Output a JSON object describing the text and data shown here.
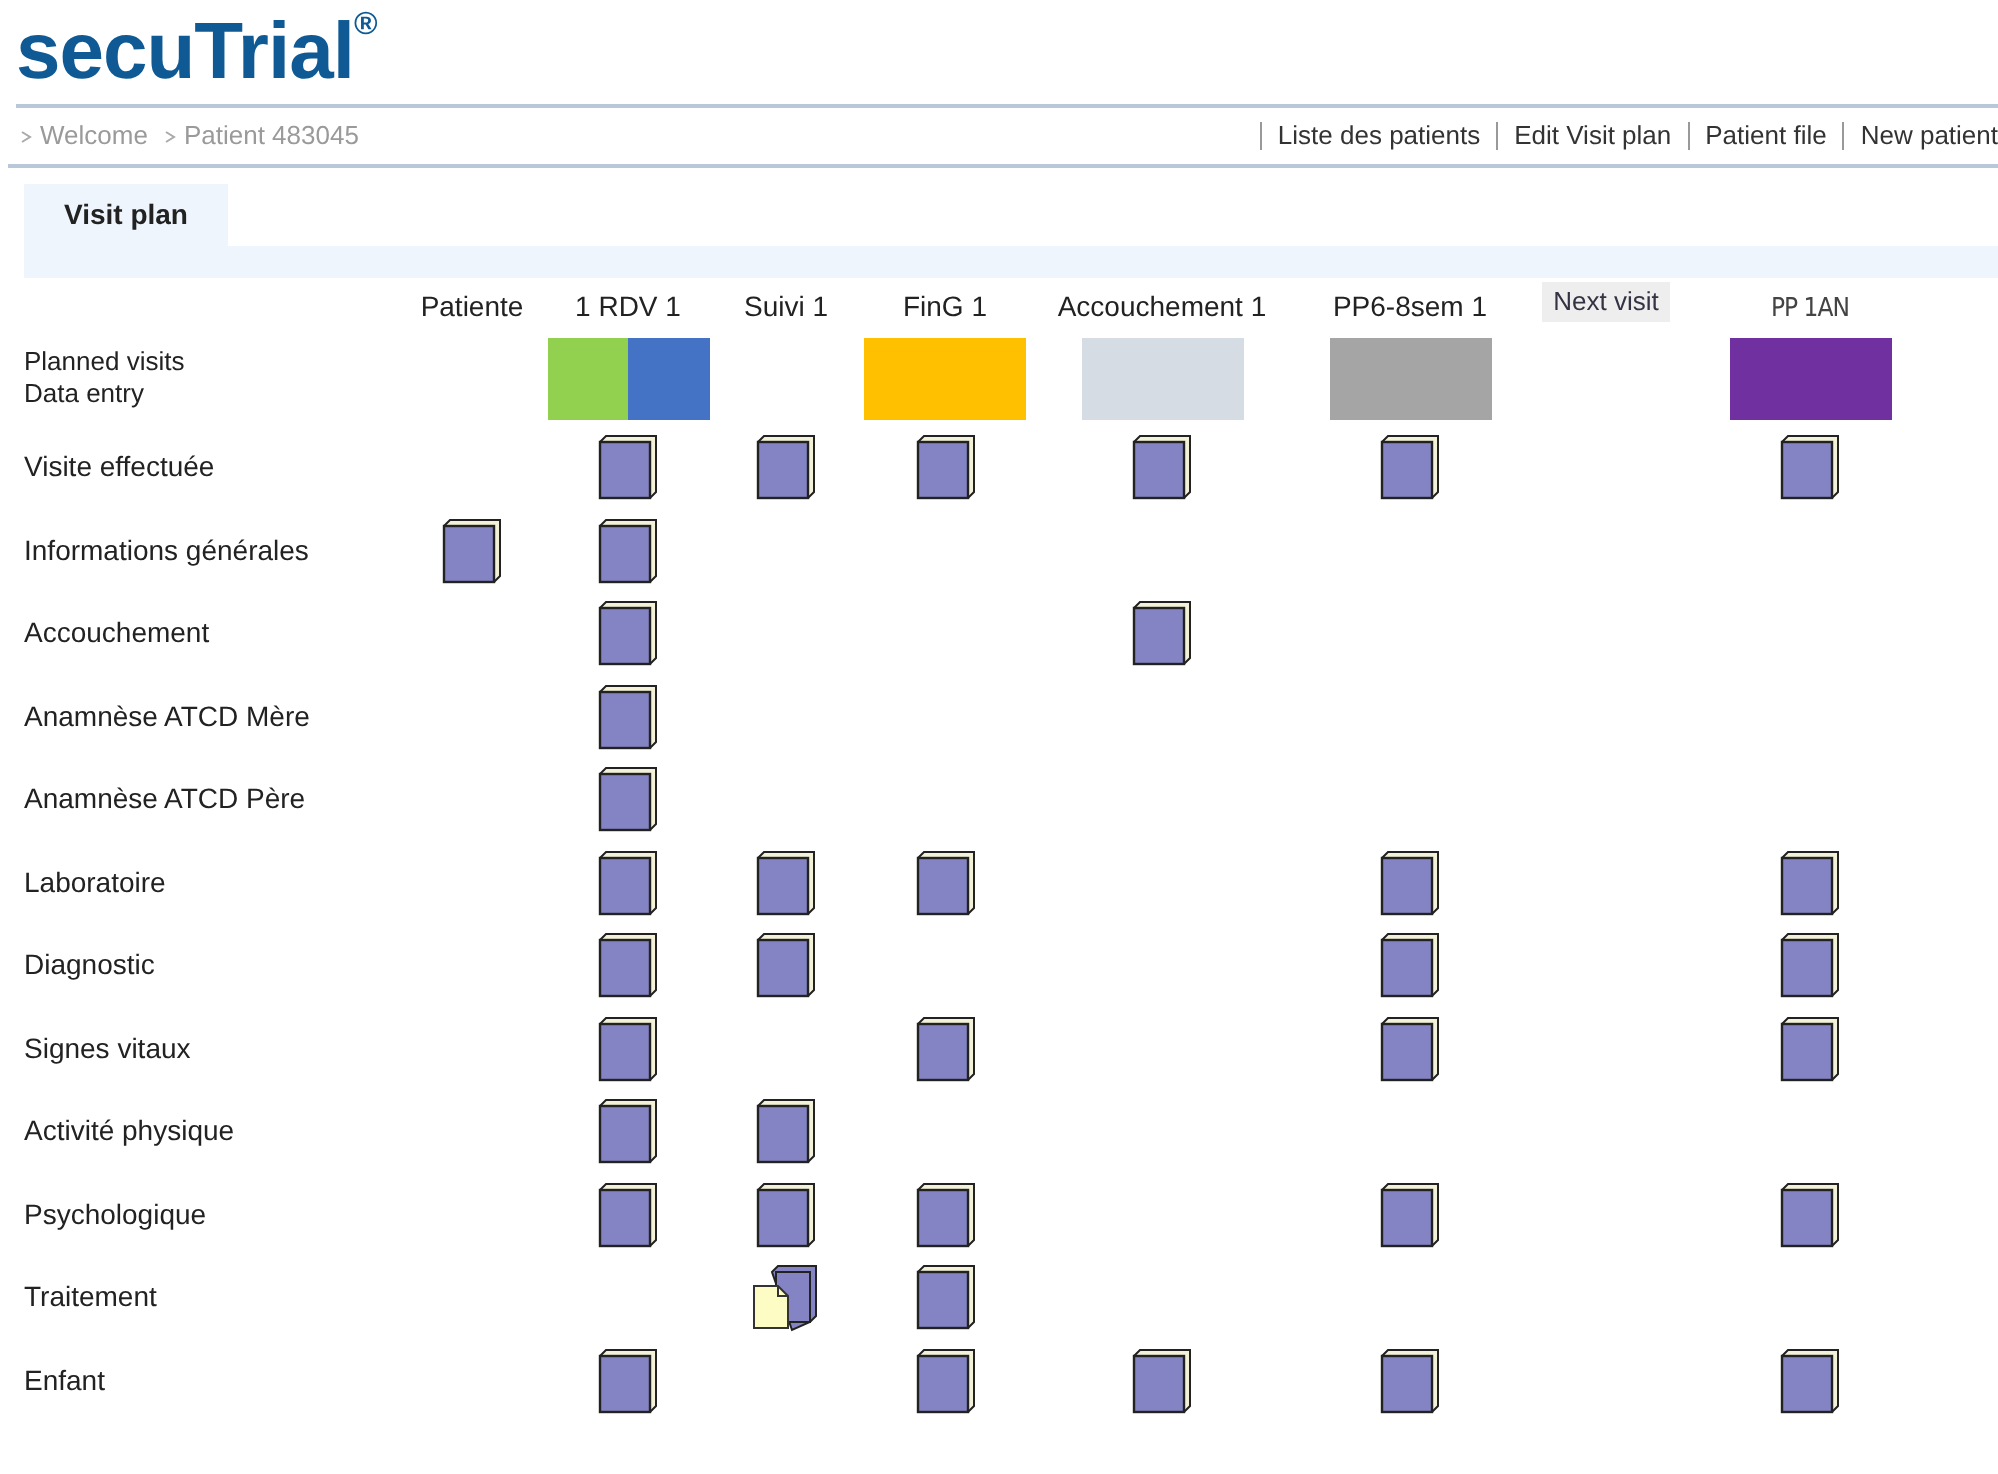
{
  "logo": {
    "name": "secuTrial",
    "mark": "®"
  },
  "breadcrumb": [
    "Welcome",
    "Patient 483045"
  ],
  "nav_links": [
    "Liste des patients",
    "Edit Visit plan",
    "Patient file",
    "New patient"
  ],
  "tabs": [
    {
      "label": "Visit plan",
      "selected": true
    }
  ],
  "visit_plan": {
    "row_labels": [
      "Planned visits",
      "Data entry"
    ],
    "columns": [
      {
        "label": "Patiente",
        "kind": "plain"
      },
      {
        "label": "1 RDV 1",
        "kind": "plain",
        "planned": [
          {
            "color": "#92d050"
          },
          {
            "color": "#4472c4"
          }
        ]
      },
      {
        "label": "Suivi 1",
        "kind": "plain"
      },
      {
        "label": "FinG 1",
        "kind": "plain",
        "planned": [
          {
            "color": "#ffc000"
          }
        ]
      },
      {
        "label": "Accouchement 1",
        "kind": "plain",
        "planned": [
          {
            "color": "#d6dce4"
          }
        ]
      },
      {
        "label": "PP6-8sem 1",
        "kind": "plain",
        "planned": [
          {
            "color": "#a5a5a5"
          }
        ]
      },
      {
        "label": "Next visit",
        "kind": "button"
      },
      {
        "label": "PP 1AN",
        "kind": "narrow",
        "planned": [
          {
            "color": "#7030a0"
          }
        ]
      }
    ],
    "rows": [
      {
        "label": "Visite effectuée",
        "cells": [
          {
            "kind": "none"
          },
          {
            "kind": "form"
          },
          {
            "kind": "form"
          },
          {
            "kind": "form"
          },
          {
            "kind": "form"
          },
          {
            "kind": "form"
          },
          {
            "kind": "none"
          },
          {
            "kind": "form"
          }
        ]
      },
      {
        "label": "Informations générales",
        "cells": [
          {
            "kind": "form"
          },
          {
            "kind": "form"
          },
          {
            "kind": "none"
          },
          {
            "kind": "none"
          },
          {
            "kind": "none"
          },
          {
            "kind": "none"
          },
          {
            "kind": "none"
          },
          {
            "kind": "none"
          }
        ]
      },
      {
        "label": "Accouchement",
        "cells": [
          {
            "kind": "none"
          },
          {
            "kind": "form"
          },
          {
            "kind": "none"
          },
          {
            "kind": "none"
          },
          {
            "kind": "form"
          },
          {
            "kind": "none"
          },
          {
            "kind": "none"
          },
          {
            "kind": "none"
          }
        ]
      },
      {
        "label": "Anamnèse ATCD Mère",
        "cells": [
          {
            "kind": "none"
          },
          {
            "kind": "form"
          },
          {
            "kind": "none"
          },
          {
            "kind": "none"
          },
          {
            "kind": "none"
          },
          {
            "kind": "none"
          },
          {
            "kind": "none"
          },
          {
            "kind": "none"
          }
        ]
      },
      {
        "label": "Anamnèse ATCD Père",
        "cells": [
          {
            "kind": "none"
          },
          {
            "kind": "form"
          },
          {
            "kind": "none"
          },
          {
            "kind": "none"
          },
          {
            "kind": "none"
          },
          {
            "kind": "none"
          },
          {
            "kind": "none"
          },
          {
            "kind": "none"
          }
        ]
      },
      {
        "label": "Laboratoire",
        "cells": [
          {
            "kind": "none"
          },
          {
            "kind": "form"
          },
          {
            "kind": "form"
          },
          {
            "kind": "form"
          },
          {
            "kind": "none"
          },
          {
            "kind": "form"
          },
          {
            "kind": "none"
          },
          {
            "kind": "form"
          }
        ]
      },
      {
        "label": "Diagnostic",
        "cells": [
          {
            "kind": "none"
          },
          {
            "kind": "form"
          },
          {
            "kind": "form"
          },
          {
            "kind": "none"
          },
          {
            "kind": "none"
          },
          {
            "kind": "form"
          },
          {
            "kind": "none"
          },
          {
            "kind": "form"
          }
        ]
      },
      {
        "label": "Signes vitaux",
        "cells": [
          {
            "kind": "none"
          },
          {
            "kind": "form"
          },
          {
            "kind": "none"
          },
          {
            "kind": "form"
          },
          {
            "kind": "none"
          },
          {
            "kind": "form"
          },
          {
            "kind": "none"
          },
          {
            "kind": "form"
          }
        ]
      },
      {
        "label": "Activité physique",
        "cells": [
          {
            "kind": "none"
          },
          {
            "kind": "form"
          },
          {
            "kind": "form"
          },
          {
            "kind": "none"
          },
          {
            "kind": "none"
          },
          {
            "kind": "none"
          },
          {
            "kind": "none"
          },
          {
            "kind": "none"
          }
        ]
      },
      {
        "label": "Psychologique",
        "cells": [
          {
            "kind": "none"
          },
          {
            "kind": "form"
          },
          {
            "kind": "form"
          },
          {
            "kind": "form"
          },
          {
            "kind": "none"
          },
          {
            "kind": "form"
          },
          {
            "kind": "none"
          },
          {
            "kind": "form"
          }
        ]
      },
      {
        "label": "Traitement",
        "cells": [
          {
            "kind": "none"
          },
          {
            "kind": "none"
          },
          {
            "kind": "form_with_doc"
          },
          {
            "kind": "form"
          },
          {
            "kind": "none"
          },
          {
            "kind": "none"
          },
          {
            "kind": "none"
          },
          {
            "kind": "none"
          }
        ]
      },
      {
        "label": "Enfant",
        "cells": [
          {
            "kind": "none"
          },
          {
            "kind": "form"
          },
          {
            "kind": "none"
          },
          {
            "kind": "form"
          },
          {
            "kind": "form"
          },
          {
            "kind": "form"
          },
          {
            "kind": "none"
          },
          {
            "kind": "form"
          }
        ]
      }
    ]
  }
}
